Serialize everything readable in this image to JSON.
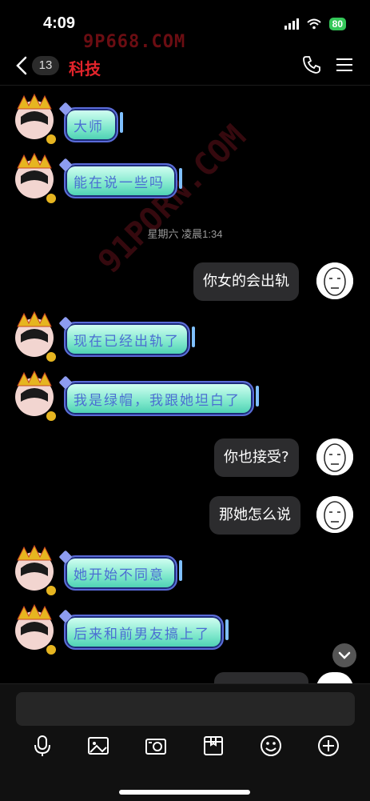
{
  "status": {
    "time": "4:09",
    "battery": "80",
    "watermark": "9P668.COM"
  },
  "header": {
    "unread_count": "13",
    "title": "科技"
  },
  "chat": {
    "timestamp": "星期六 凌晨1:34",
    "messages": [
      {
        "side": "left",
        "text": "大师"
      },
      {
        "side": "left",
        "text": "能在说一些吗"
      },
      {
        "side": "right",
        "text": "你女的会出轨"
      },
      {
        "side": "left",
        "text": "现在已经出轨了"
      },
      {
        "side": "left",
        "text": "我是绿帽，我跟她坦白了"
      },
      {
        "side": "right",
        "text": "你也接受?"
      },
      {
        "side": "right",
        "text": "那她怎么说"
      },
      {
        "side": "left",
        "text": "她开始不同意"
      },
      {
        "side": "left",
        "text": "后来和前男友搞上了"
      }
    ],
    "watermark": "91PORN.COM"
  },
  "icons": [
    "back-icon",
    "phone-icon",
    "menu-icon",
    "mic-icon",
    "image-icon",
    "camera-icon",
    "package-icon",
    "emoji-icon",
    "plus-icon",
    "chevron-down-icon"
  ]
}
